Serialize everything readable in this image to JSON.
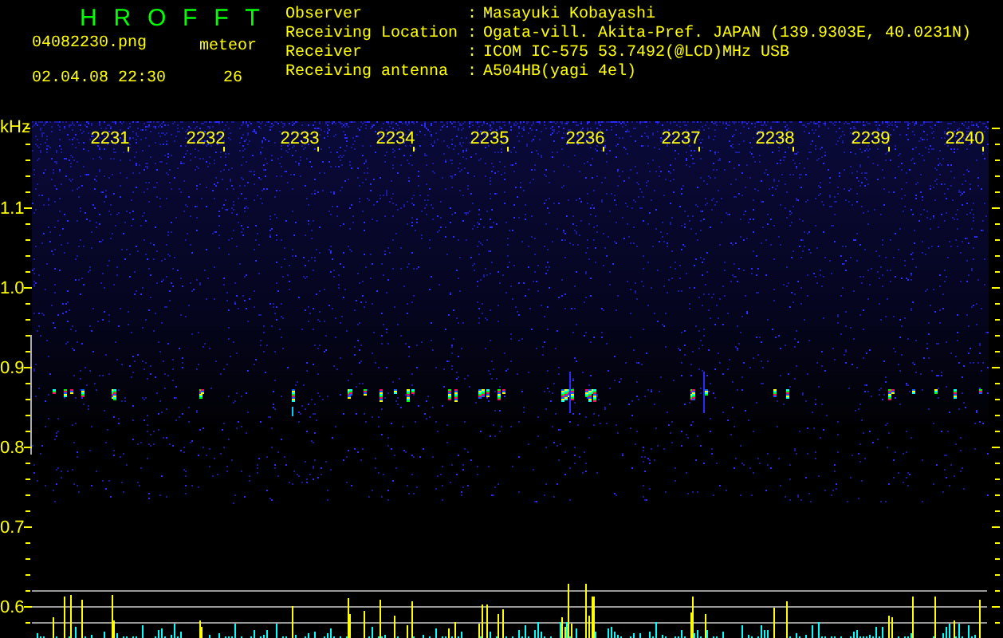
{
  "header": {
    "title": "HROFFT",
    "file_name": "04082230.png",
    "timestamp": "02.04.08 22:30",
    "meteor_label": "meteor",
    "meteor_count": "26"
  },
  "station_info": [
    {
      "label": "Observer",
      "separator": ":",
      "value": "Masayuki Kobayashi"
    },
    {
      "label": "Receiving Location",
      "separator": ":",
      "value": "Ogata-vill. Akita-Pref. JAPAN (139.9303E, 40.0231N)"
    },
    {
      "label": "Receiver",
      "separator": ":",
      "value": "ICOM IC-575 53.7492(@LCD)MHz USB"
    },
    {
      "label": "Receiving antenna",
      "separator": ":",
      "value": "A504HB(yagi 4el)"
    }
  ],
  "spectrogram": {
    "y_unit": "kHz",
    "x_labels": [
      "2231",
      "2232",
      "2233",
      "2234",
      "2235",
      "2236",
      "2237",
      "2238",
      "2239",
      "2240"
    ],
    "y_labels": [
      "1.1",
      "1.0",
      "0.9",
      "0.8",
      "0.7",
      "0.6"
    ]
  }
}
